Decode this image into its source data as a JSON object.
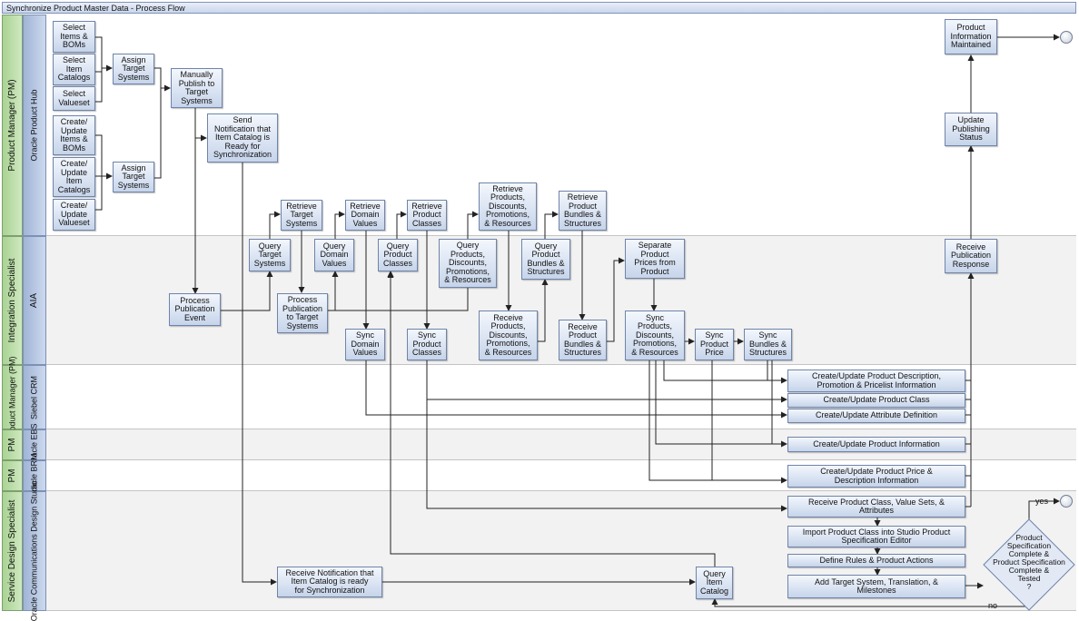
{
  "title": "Synchronize Product Master Data - Process Flow",
  "lanes": {
    "pm_role": "Product Manager (PM)",
    "pm_sys": "Oracle\nProduct Hub",
    "is_role": "Integration Specialist",
    "is_sys": "AIA",
    "crm_role": "Product\nManager (PM)",
    "crm_sys": "Siebel\nCRM",
    "ebs_role": "PM",
    "ebs_sys": "Oracle\nEBS",
    "brm_role": "PM",
    "brm_sys": "Oracle\nBRM",
    "sds_role": "Service Design Specialist",
    "sds_sys": "Oracle Communications\nDesign Studio"
  },
  "tasks": {
    "select_items_boms": "Select\nItems &\nBOMs",
    "select_item_catalogs": "Select\nItem\nCatalogs",
    "select_valueset": "Select\nValueset",
    "create_update_items_boms": "Create/\nUpdate\nItems &\nBOMs",
    "create_update_item_catalogs": "Create/\nUpdate\nItem\nCatalogs",
    "create_update_valueset": "Create/\nUpdate\nValueset",
    "assign_target_systems_1": "Assign\nTarget\nSystems",
    "assign_target_systems_2": "Assign\nTarget\nSystems",
    "manually_publish": "Manually\nPublish to\nTarget\nSystems",
    "send_notification": "Send\nNotification that\nItem Catalog is\nReady for\nSynchronization",
    "process_publication_event": "Process\nPublication\nEvent",
    "query_target_systems": "Query\nTarget\nSystems",
    "retrieve_target_systems": "Retrieve\nTarget\nSystems",
    "process_publication_to_target": "Process\nPublication\nto Target\nSystems",
    "query_domain_values": "Query\nDomain\nValues",
    "retrieve_domain_values": "Retrieve\nDomain\nValues",
    "sync_domain_values": "Sync\nDomain\nValues",
    "query_product_classes": "Query\nProduct\nClasses",
    "retrieve_product_classes": "Retrieve\nProduct\nClasses",
    "sync_product_classes": "Sync\nProduct\nClasses",
    "query_products_discounts": "Query\nProducts,\nDiscounts,\nPromotions,\n& Resources",
    "retrieve_products_discounts": "Retrieve\nProducts,\nDiscounts,\nPromotions,\n& Resources",
    "receive_products_discounts": "Receive\nProducts,\nDiscounts,\nPromotions,\n& Resources",
    "query_product_bundles": "Query\nProduct\nBundles &\nStructures",
    "retrieve_product_bundles": "Retrieve\nProduct\nBundles &\nStructures",
    "receive_product_bundles": "Receive\nProduct\nBundles &\nStructures",
    "separate_product_prices": "Separate\nProduct\nPrices from\nProduct",
    "sync_products_discounts": "Sync\nProducts,\nDiscounts,\nPromotions,\n& Resources",
    "sync_product_price": "Sync\nProduct\nPrice",
    "sync_bundles_structures": "Sync\nBundles &\nStructures",
    "receive_publication_response": "Receive\nPublication\nResponse",
    "update_publishing_status": "Update\nPublishing\nStatus",
    "product_information_maintained": "Product\nInformation\nMaintained",
    "crm_create_update_description": "Create/Update Product Description,\nPromotion & Pricelist Information",
    "crm_create_update_class": "Create/Update Product Class",
    "crm_create_update_attribute": "Create/Update Attribute Definition",
    "ebs_create_update_info": "Create/Update Product Information",
    "brm_create_update_price": "Create/Update Product Price &\nDescription Information",
    "sds_receive_class": "Receive Product Class, Value Sets, &\nAttributes",
    "sds_import_class": "Import Product Class into Studio Product\nSpecification Editor",
    "sds_define_rules": "Define Rules & Product Actions",
    "sds_add_target": "Add Target System, Translation, &\nMilestones",
    "sds_receive_notification": "Receive Notification that\nItem Catalog is ready\nfor Synchronization",
    "sds_query_item_catalog": "Query\nItem\nCatalog"
  },
  "decision": {
    "question": "Product\nSpecification\nComplete &\nProduct Specification\nComplete &\nTested\n?",
    "yes_label": "yes",
    "no_label": "no"
  },
  "colors": {
    "task_fill_top": "#f3f7fd",
    "task_fill_bottom": "#c6d4ea",
    "task_border": "#6f84a8",
    "role_lane": "#b8dca4",
    "system_lane": "#b3c6e4",
    "alt_lane": "#f2f2f2"
  }
}
